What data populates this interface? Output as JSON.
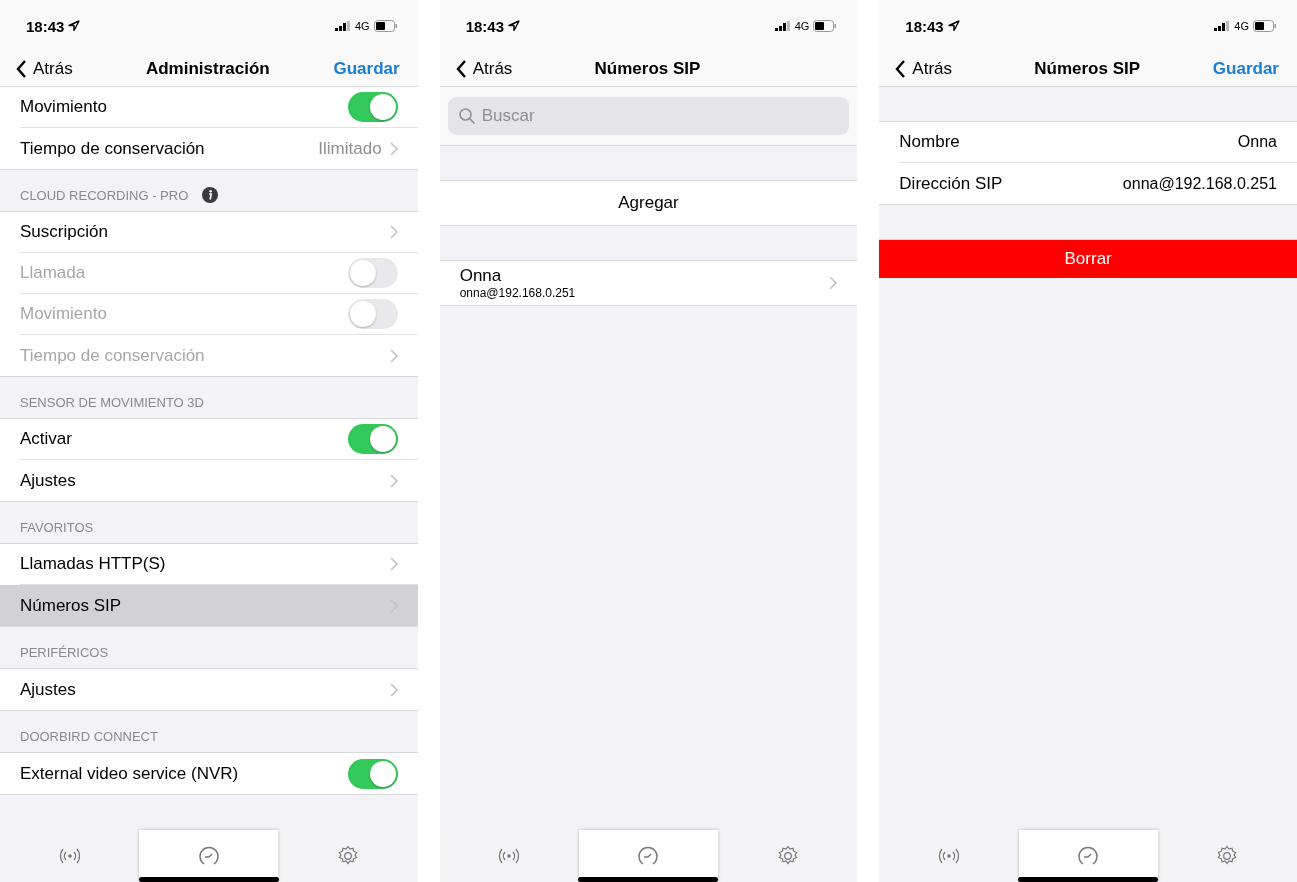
{
  "screens": [
    {
      "status": {
        "time": "18:43",
        "network": "4G"
      },
      "nav": {
        "back": "Atrás",
        "title": "Administración",
        "action": "Guardar"
      },
      "rows": [
        {
          "kind": "toggle",
          "label": "Movimiento",
          "on": true,
          "disabled": false,
          "selected": false
        },
        {
          "kind": "link",
          "label": "Tiempo de conservación",
          "value": "Ilimitado",
          "disabled": false,
          "selected": false
        }
      ],
      "sections": [
        {
          "header": "CLOUD RECORDING - PRO",
          "info": true,
          "rows": [
            {
              "kind": "link",
              "label": "Suscripción",
              "disabled": false,
              "selected": false
            },
            {
              "kind": "toggle",
              "label": "Llamada",
              "on": false,
              "disabled": true,
              "selected": false
            },
            {
              "kind": "toggle",
              "label": "Movimiento",
              "on": false,
              "disabled": true,
              "selected": false
            },
            {
              "kind": "link",
              "label": "Tiempo de conservación",
              "disabled": true,
              "selected": false
            }
          ]
        },
        {
          "header": "SENSOR DE MOVIMIENTO 3D",
          "rows": [
            {
              "kind": "toggle",
              "label": "Activar",
              "on": true,
              "disabled": false,
              "selected": false
            },
            {
              "kind": "link",
              "label": "Ajustes",
              "disabled": false,
              "selected": false
            }
          ]
        },
        {
          "header": "FAVORITOS",
          "rows": [
            {
              "kind": "link",
              "label": "Llamadas HTTP(S)",
              "disabled": false,
              "selected": false
            },
            {
              "kind": "link",
              "label": "Números SIP",
              "disabled": false,
              "selected": true
            }
          ]
        },
        {
          "header": "PERIFÉRICOS",
          "rows": [
            {
              "kind": "link",
              "label": "Ajustes",
              "disabled": false,
              "selected": false
            }
          ]
        },
        {
          "header": "DOORBIRD CONNECT",
          "rows": [
            {
              "kind": "toggle",
              "label": "External video service (NVR)",
              "on": true,
              "disabled": false,
              "selected": false
            }
          ]
        }
      ],
      "tabs": [
        {
          "selected": false
        },
        {
          "selected": true
        },
        {
          "selected": false
        }
      ]
    },
    {
      "status": {
        "time": "18:43",
        "network": "4G"
      },
      "nav": {
        "back": "Atrás",
        "title": "Números SIP"
      },
      "search": {
        "placeholder": "Buscar"
      },
      "sections": [
        {
          "rows": [
            {
              "kind": "action",
              "label": "Agregar"
            }
          ]
        },
        {
          "rows": [
            {
              "kind": "subtitle",
              "label": "Onna",
              "subtitle": "onna@192.168.0.251"
            }
          ]
        }
      ],
      "tabs": [
        {
          "selected": false
        },
        {
          "selected": true
        },
        {
          "selected": false
        }
      ]
    },
    {
      "status": {
        "time": "18:43",
        "network": "4G"
      },
      "nav": {
        "back": "Atrás",
        "title": "Números SIP",
        "action": "Guardar"
      },
      "sections": [
        {
          "rows": [
            {
              "kind": "value",
              "label": "Nombre",
              "value": "Onna"
            },
            {
              "kind": "value",
              "label": "Dirección SIP",
              "value": "onna@192.168.0.251"
            }
          ]
        },
        {
          "rows": [
            {
              "kind": "destructive",
              "label": "Borrar"
            }
          ]
        }
      ],
      "tabs": [
        {
          "selected": false
        },
        {
          "selected": true
        },
        {
          "selected": false
        }
      ]
    }
  ]
}
